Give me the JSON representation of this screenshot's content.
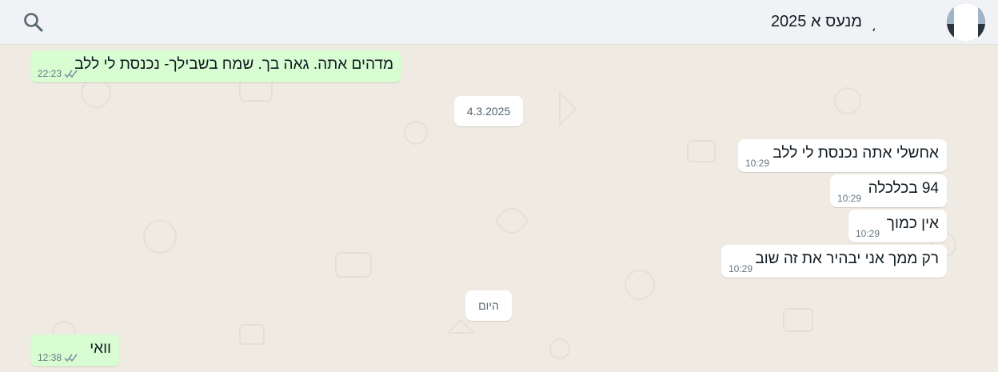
{
  "header": {
    "chat_name": "מנעס א 2025",
    "title_mark": "،"
  },
  "dates": {
    "first": "4.3.2025",
    "second": "היום"
  },
  "messages": [
    {
      "text": "מדהים אתה. גאה בך. שמח בשבילך- נכנסת לי ללב",
      "time": "22:23",
      "direction": "outgoing"
    },
    {
      "text": "אחשלי אתה נכנסת לי ללב",
      "time": "10:29",
      "direction": "incoming"
    },
    {
      "text": "94 בכלכלה",
      "time": "10:29",
      "direction": "incoming"
    },
    {
      "text": "אין כמוך",
      "time": "10:29",
      "direction": "incoming"
    },
    {
      "text": "רק ממך אני יבהיר את זה שוב",
      "time": "10:29",
      "direction": "incoming"
    },
    {
      "text": "וואי",
      "time": "12:38",
      "direction": "outgoing"
    }
  ],
  "icons": {
    "search": "search-icon",
    "read_receipt": "double-check-icon"
  },
  "colors": {
    "wallpaper": "#efeae2",
    "outgoing_bubble": "#d9fdd3",
    "incoming_bubble": "#ffffff",
    "header": "#f0f2f5"
  }
}
